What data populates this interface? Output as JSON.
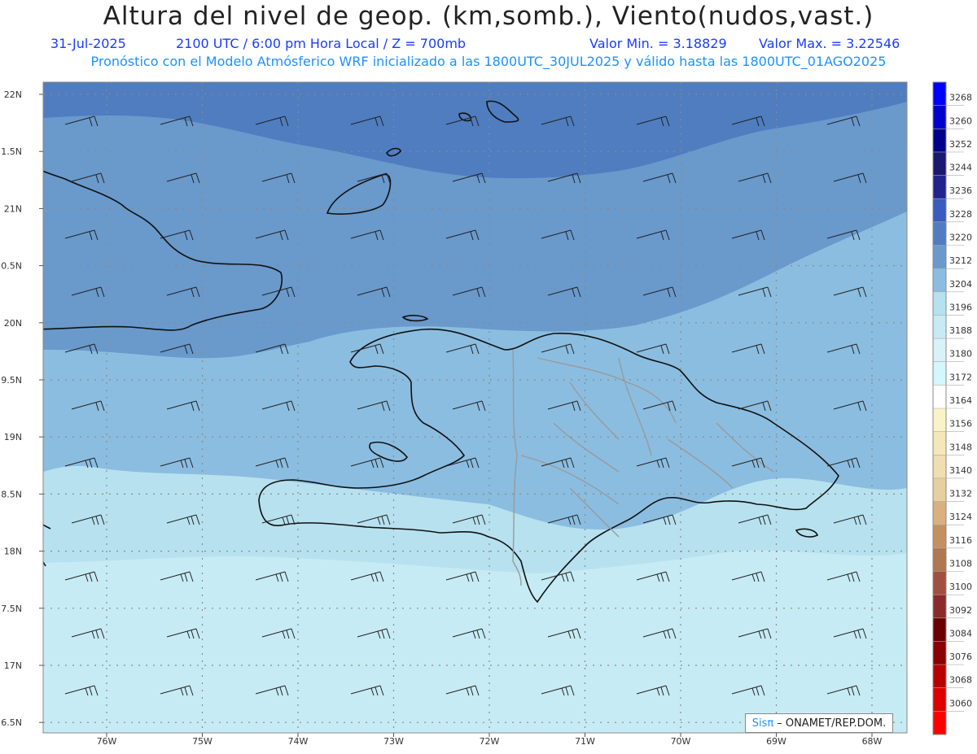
{
  "header": {
    "title": "Altura del nivel de geop. (km,somb.), Viento(nudos,vast.)",
    "date": "31-Jul-2025",
    "time_info": "2100 UTC / 6:00 pm Hora Local / Z = 700mb",
    "min_value": "Valor Min. = 3.18829",
    "max_value": "Valor Max. = 3.22546",
    "forecast_info": "Pronóstico con el Modelo Atmósferico WRF inicializado a las 1800UTC_30JUL2025 y válido hasta las  1800UTC_01AGO2025"
  },
  "latitude_labels": [
    "22N",
    "1.5N",
    "21N",
    "0.5N",
    "20N",
    "9.5N",
    "19N",
    "8.5N",
    "18N",
    "7.5N",
    "17N",
    "6.5N"
  ],
  "longitude_labels": [
    "76W",
    "75W",
    "74W",
    "73W",
    "72W",
    "71W",
    "70W",
    "69W",
    "68W"
  ],
  "colorbar": {
    "labels": [
      "3268",
      "3260",
      "3252",
      "3244",
      "3236",
      "3228",
      "3220",
      "3212",
      "3204",
      "3196",
      "3188",
      "3180",
      "3172",
      "3164",
      "3156",
      "3148",
      "3140",
      "3132",
      "3124",
      "3116",
      "3108",
      "3100",
      "3092",
      "3084",
      "3076",
      "3068",
      "3060"
    ],
    "colors": [
      "#0000ff",
      "#0000cd",
      "#00008b",
      "#191970",
      "#23238e",
      "#3a5bbf",
      "#4f7dc0",
      "#6a99cc",
      "#8bbde0",
      "#b7e1ef",
      "#c7ebf4",
      "#d8f2f8",
      "#d4f7fb",
      "#ffffff",
      "#fbf3c8",
      "#f5e8b8",
      "#f0ddb0",
      "#e8cfa0",
      "#d9b080",
      "#c49060",
      "#b07850",
      "#a05040",
      "#8b2a2a",
      "#6b0000",
      "#8b0000",
      "#b80000",
      "#dd0000",
      "#ff0000"
    ]
  },
  "map_colors": {
    "deep": "#4f7dc0",
    "mid": "#6a99cc",
    "light": "#8bbde0",
    "pale": "#b7e1ef",
    "palest": "#c7ebf4"
  },
  "credit": {
    "brand": "Sisπ",
    "org": "– ONAMET/REP.DOM."
  }
}
